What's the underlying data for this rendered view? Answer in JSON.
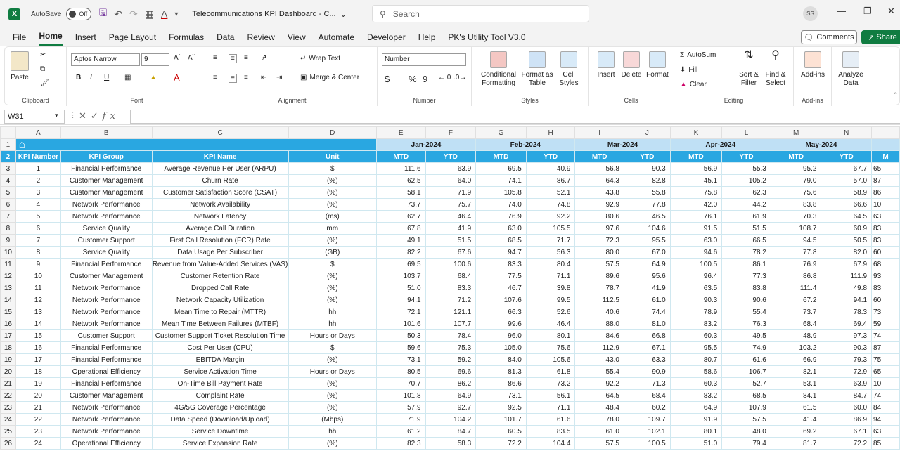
{
  "titlebar": {
    "autosave_label": "AutoSave",
    "autosave_state": "Off",
    "doc_title": "Telecommunications KPI Dashboard - C...",
    "search_placeholder": "Search",
    "user_initials": "SS"
  },
  "menu": {
    "items": [
      "File",
      "Home",
      "Insert",
      "Page Layout",
      "Formulas",
      "Data",
      "Review",
      "View",
      "Automate",
      "Developer",
      "Help",
      "PK's Utility Tool V3.0"
    ],
    "active": "Home",
    "comments_label": "Comments",
    "share_label": "Share"
  },
  "ribbon": {
    "clipboard": {
      "paste": "Paste",
      "label": "Clipboard"
    },
    "font": {
      "family": "Aptos Narrow",
      "size": "9",
      "label": "Font",
      "bold": "B",
      "italic": "I",
      "underline": "U"
    },
    "alignment": {
      "wrap": "Wrap Text",
      "merge": "Merge & Center",
      "label": "Alignment"
    },
    "number": {
      "format": "Number",
      "currency": "$",
      "percent": "%",
      "comma": "9",
      "label": "Number"
    },
    "styles": {
      "conditional": "Conditional Formatting",
      "format_table": "Format as Table",
      "cell_styles": "Cell Styles",
      "label": "Styles"
    },
    "cells": {
      "insert": "Insert",
      "delete": "Delete",
      "format": "Format",
      "label": "Cells"
    },
    "editing": {
      "autosum": "AutoSum",
      "fill": "Fill",
      "clear": "Clear",
      "sort": "Sort & Filter",
      "find": "Find & Select",
      "label": "Editing"
    },
    "addins": {
      "addins": "Add-ins",
      "label": "Add-ins"
    },
    "analyze": {
      "analyze": "Analyze Data"
    }
  },
  "formula": {
    "namebox": "W31",
    "fx": "fx",
    "value": ""
  },
  "sheet": {
    "columns": [
      "A",
      "B",
      "C",
      "D",
      "E",
      "F",
      "G",
      "H",
      "I",
      "J",
      "K",
      "L",
      "M",
      "N",
      ""
    ],
    "months": [
      "Jan-2024",
      "Feb-2024",
      "Mar-2024",
      "Apr-2024",
      "May-2024"
    ],
    "headers": [
      "KPI Number",
      "KPI Group",
      "KPI Name",
      "Unit",
      "MTD",
      "YTD",
      "MTD",
      "YTD",
      "MTD",
      "YTD",
      "MTD",
      "YTD",
      "MTD",
      "YTD",
      "M"
    ],
    "rows": [
      [
        "1",
        "Financial Performance",
        "Average Revenue Per User (ARPU)",
        "$",
        "111.6",
        "63.9",
        "69.5",
        "40.9",
        "56.8",
        "90.3",
        "56.9",
        "55.3",
        "95.2",
        "67.7",
        "65"
      ],
      [
        "2",
        "Customer Management",
        "Churn Rate",
        "(%)",
        "62.5",
        "64.0",
        "74.1",
        "86.7",
        "64.3",
        "82.8",
        "45.1",
        "105.2",
        "79.0",
        "57.0",
        "87"
      ],
      [
        "3",
        "Customer Management",
        "Customer Satisfaction Score (CSAT)",
        "(%)",
        "58.1",
        "71.9",
        "105.8",
        "52.1",
        "43.8",
        "55.8",
        "75.8",
        "62.3",
        "75.6",
        "58.9",
        "86"
      ],
      [
        "4",
        "Network Performance",
        "Network Availability",
        "(%)",
        "73.7",
        "75.7",
        "74.0",
        "74.8",
        "92.9",
        "77.8",
        "42.0",
        "44.2",
        "83.8",
        "66.6",
        "10"
      ],
      [
        "5",
        "Network Performance",
        "Network Latency",
        "(ms)",
        "62.7",
        "46.4",
        "76.9",
        "92.2",
        "80.6",
        "46.5",
        "76.1",
        "61.9",
        "70.3",
        "64.5",
        "63"
      ],
      [
        "6",
        "Service Quality",
        "Average Call Duration",
        "mm",
        "67.8",
        "41.9",
        "63.0",
        "105.5",
        "97.6",
        "104.6",
        "91.5",
        "51.5",
        "108.7",
        "60.9",
        "83"
      ],
      [
        "7",
        "Customer Support",
        "First Call Resolution (FCR) Rate",
        "(%)",
        "49.1",
        "51.5",
        "68.5",
        "71.7",
        "72.3",
        "95.5",
        "63.0",
        "66.5",
        "94.5",
        "50.5",
        "83"
      ],
      [
        "8",
        "Service Quality",
        "Data Usage Per Subscriber",
        "(GB)",
        "82.2",
        "67.6",
        "94.7",
        "56.3",
        "80.0",
        "67.0",
        "94.6",
        "78.2",
        "77.8",
        "82.0",
        "60"
      ],
      [
        "9",
        "Financial Performance",
        "Revenue from Value-Added Services (VAS)",
        "$",
        "69.5",
        "100.6",
        "83.3",
        "80.4",
        "57.5",
        "64.9",
        "100.5",
        "86.1",
        "76.9",
        "67.9",
        "68"
      ],
      [
        "10",
        "Customer Management",
        "Customer Retention Rate",
        "(%)",
        "103.7",
        "68.4",
        "77.5",
        "71.1",
        "89.6",
        "95.6",
        "96.4",
        "77.3",
        "86.8",
        "111.9",
        "93"
      ],
      [
        "11",
        "Network Performance",
        "Dropped Call Rate",
        "(%)",
        "51.0",
        "83.3",
        "46.7",
        "39.8",
        "78.7",
        "41.9",
        "63.5",
        "83.8",
        "111.4",
        "49.8",
        "83"
      ],
      [
        "12",
        "Network Performance",
        "Network Capacity Utilization",
        "(%)",
        "94.1",
        "71.2",
        "107.6",
        "99.5",
        "112.5",
        "61.0",
        "90.3",
        "90.6",
        "67.2",
        "94.1",
        "60"
      ],
      [
        "13",
        "Network Performance",
        "Mean Time to Repair (MTTR)",
        "hh",
        "72.1",
        "121.1",
        "66.3",
        "52.6",
        "40.6",
        "74.4",
        "78.9",
        "55.4",
        "73.7",
        "78.3",
        "73"
      ],
      [
        "14",
        "Network Performance",
        "Mean Time Between Failures (MTBF)",
        "hh",
        "101.6",
        "107.7",
        "99.6",
        "46.4",
        "88.0",
        "81.0",
        "83.2",
        "76.3",
        "68.4",
        "69.4",
        "59"
      ],
      [
        "15",
        "Customer Support",
        "Customer Support Ticket Resolution Time",
        "Hours or Days",
        "50.3",
        "78.4",
        "96.0",
        "80.1",
        "84.6",
        "66.8",
        "60.3",
        "49.5",
        "48.9",
        "97.3",
        "74"
      ],
      [
        "16",
        "Financial Performance",
        "Cost Per User (CPU)",
        "$",
        "59.6",
        "75.3",
        "105.0",
        "75.6",
        "112.9",
        "67.1",
        "95.5",
        "74.9",
        "103.2",
        "90.3",
        "87"
      ],
      [
        "17",
        "Financial Performance",
        "EBITDA Margin",
        "(%)",
        "73.1",
        "59.2",
        "84.0",
        "105.6",
        "43.0",
        "63.3",
        "80.7",
        "61.6",
        "66.9",
        "79.3",
        "75"
      ],
      [
        "18",
        "Operational Efficiency",
        "Service Activation Time",
        "Hours or Days",
        "80.5",
        "69.6",
        "81.3",
        "61.8",
        "55.4",
        "90.9",
        "58.6",
        "106.7",
        "82.1",
        "72.9",
        "65"
      ],
      [
        "19",
        "Financial Performance",
        "On-Time Bill Payment Rate",
        "(%)",
        "70.7",
        "86.2",
        "86.6",
        "73.2",
        "92.2",
        "71.3",
        "60.3",
        "52.7",
        "53.1",
        "63.9",
        "10"
      ],
      [
        "20",
        "Customer Management",
        "Complaint Rate",
        "(%)",
        "101.8",
        "64.9",
        "73.1",
        "56.1",
        "64.5",
        "68.4",
        "83.2",
        "68.5",
        "84.1",
        "84.7",
        "74"
      ],
      [
        "21",
        "Network Performance",
        "4G/5G Coverage Percentage",
        "(%)",
        "57.9",
        "92.7",
        "92.5",
        "71.1",
        "48.4",
        "60.2",
        "64.9",
        "107.9",
        "61.5",
        "60.0",
        "84"
      ],
      [
        "22",
        "Network Performance",
        "Data Speed (Download/Upload)",
        "(Mbps)",
        "71.9",
        "104.2",
        "101.7",
        "61.6",
        "78.0",
        "109.7",
        "91.9",
        "57.5",
        "41.4",
        "86.9",
        "94"
      ],
      [
        "23",
        "Network Performance",
        "Service Downtime",
        "hh",
        "61.2",
        "84.7",
        "60.5",
        "83.5",
        "61.0",
        "102.1",
        "80.1",
        "48.0",
        "69.2",
        "67.1",
        "63"
      ],
      [
        "24",
        "Operational Efficiency",
        "Service Expansion Rate",
        "(%)",
        "82.3",
        "58.3",
        "72.2",
        "104.4",
        "57.5",
        "100.5",
        "51.0",
        "79.4",
        "81.7",
        "72.2",
        "85"
      ]
    ]
  }
}
